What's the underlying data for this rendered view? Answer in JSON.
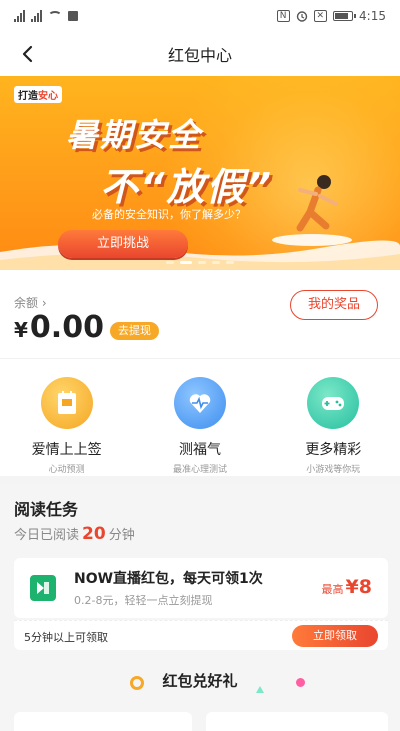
{
  "status_bar": {
    "time": "4:15"
  },
  "nav": {
    "title": "红包中心"
  },
  "banner": {
    "logo_left": "打造",
    "logo_right": "安心",
    "title_line1": "暑期安全",
    "title_line2": "不“放假”",
    "subtitle": "必备的安全知识，你了解多少？",
    "button": "立即挑战"
  },
  "balance": {
    "label": "余额 ›",
    "currency": "¥",
    "amount": "0.00",
    "withdraw": "去提现",
    "prizes": "我的奖品"
  },
  "entries": [
    {
      "title": "爱情上上签",
      "subtitle": "心动预测",
      "icon": "envelope-icon",
      "color": "#f5a623"
    },
    {
      "title": "测福气",
      "subtitle": "最准心理测试",
      "icon": "heart-icon",
      "color": "#3d8ef0"
    },
    {
      "title": "更多精彩",
      "subtitle": "小游戏等你玩",
      "icon": "gamepad-icon",
      "color": "#25bfa0"
    }
  ],
  "tasks": {
    "title": "阅读任务",
    "read_prefix": "今日已阅读",
    "read_minutes": "20",
    "read_unit": "分钟",
    "card": {
      "name": "NOW直播红包，每天可领1次",
      "desc": "0.2-8元，轻轻一点立刻提现",
      "max_label": "最高",
      "max_value": "¥8",
      "icon": "now-logo-icon"
    },
    "claim_text": "5分钟以上可领取",
    "claim_button": "立即领取",
    "redeem_title": "红包兑好礼"
  }
}
